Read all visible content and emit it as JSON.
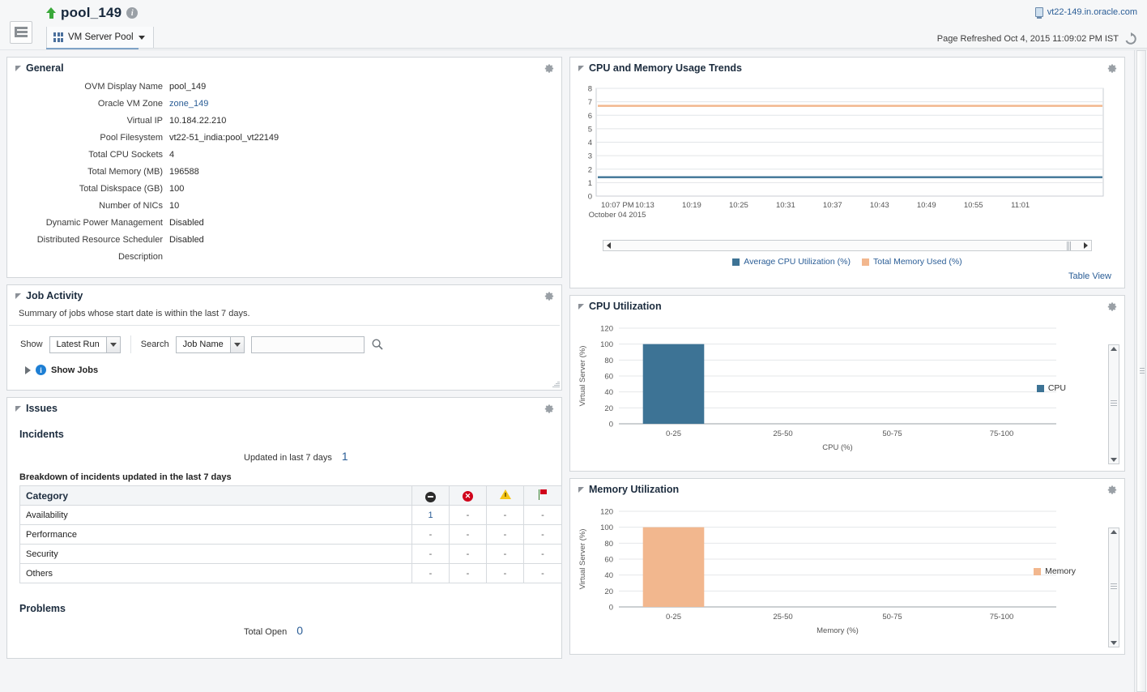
{
  "header": {
    "page_title": "pool_149",
    "info_icon": "info-icon",
    "status_icon": "up-arrow-icon",
    "target_menu_label": "VM Server Pool",
    "host_link": "vt22-149.in.oracle.com",
    "refresh_text": "Page Refreshed Oct 4, 2015 11:09:02 PM IST",
    "sidebar_toggle_icon": "sidebar-toggle-icon",
    "refresh_icon": "refresh-icon"
  },
  "general": {
    "title": "General",
    "gear_icon": "gear-icon",
    "rows": [
      {
        "label": "OVM Display Name",
        "value": "pool_149",
        "link": false
      },
      {
        "label": "Oracle VM Zone",
        "value": "zone_149",
        "link": true
      },
      {
        "label": "Virtual IP",
        "value": "10.184.22.210",
        "link": false
      },
      {
        "label": "Pool Filesystem",
        "value": "vt22-51_india:pool_vt22149",
        "link": false
      },
      {
        "label": "Total CPU Sockets",
        "value": "4",
        "link": false
      },
      {
        "label": "Total Memory (MB)",
        "value": "196588",
        "link": false
      },
      {
        "label": "Total Diskspace (GB)",
        "value": "100",
        "link": false
      },
      {
        "label": "Number of NICs",
        "value": "10",
        "link": false
      },
      {
        "label": "Dynamic Power Management",
        "value": "Disabled",
        "link": false
      },
      {
        "label": "Distributed Resource Scheduler",
        "value": "Disabled",
        "link": false
      },
      {
        "label": "Description",
        "value": "",
        "link": false
      }
    ]
  },
  "job_activity": {
    "title": "Job Activity",
    "gear_icon": "gear-icon",
    "description": "Summary of jobs whose start date is within the last 7 days.",
    "show_label": "Show",
    "show_value": "Latest Run",
    "search_label": "Search",
    "search_value": "Job Name",
    "search_input_value": "",
    "search_icon": "search-icon",
    "show_jobs_label": "Show Jobs"
  },
  "issues": {
    "title": "Issues",
    "gear_icon": "gear-icon",
    "incidents_heading": "Incidents",
    "updated_label": "Updated in last 7 days",
    "updated_count": "1",
    "breakdown_label": "Breakdown of incidents updated in the last 7 days",
    "table": {
      "columns": [
        "Category",
        "fatal-icon",
        "critical-icon",
        "warning-icon",
        "flag-icon"
      ],
      "category_header": "Category",
      "rows": [
        {
          "category": "Availability",
          "fatal": "1",
          "critical": "-",
          "warning": "-",
          "flag": "-",
          "fatal_link": true
        },
        {
          "category": "Performance",
          "fatal": "-",
          "critical": "-",
          "warning": "-",
          "flag": "-",
          "fatal_link": false
        },
        {
          "category": "Security",
          "fatal": "-",
          "critical": "-",
          "warning": "-",
          "flag": "-",
          "fatal_link": false
        },
        {
          "category": "Others",
          "fatal": "-",
          "critical": "-",
          "warning": "-",
          "flag": "-",
          "fatal_link": false
        }
      ]
    },
    "problems_heading": "Problems",
    "total_open_label": "Total Open",
    "total_open_value": "0"
  },
  "colors": {
    "cpu_blue": "#3d7395",
    "memory_orange": "#f2b78e",
    "link_blue": "#2a5d96"
  },
  "trends_panel": {
    "title": "CPU and Memory Usage Trends",
    "gear_icon": "gear-icon",
    "table_view_link": "Table View",
    "scroll_left_icon": "scroll-left-icon",
    "scroll_right_icon": "scroll-right-icon"
  },
  "cpu_panel": {
    "title": "CPU Utilization",
    "gear_icon": "gear-icon"
  },
  "memory_panel": {
    "title": "Memory Utilization",
    "gear_icon": "gear-icon"
  },
  "chart_data": [
    {
      "type": "line",
      "title": "CPU and Memory Usage Trends",
      "xlabel": "October 04 2015",
      "ylabel": "",
      "ylim": [
        0,
        8
      ],
      "yticks": [
        0,
        1,
        2,
        3,
        4,
        5,
        6,
        7,
        8
      ],
      "x": [
        "10:07 PM",
        "10:13",
        "10:19",
        "10:25",
        "10:31",
        "10:37",
        "10:43",
        "10:49",
        "10:55",
        "11:01"
      ],
      "grid": true,
      "legend_position": "bottom",
      "series": [
        {
          "name": "Average CPU Utilization (%)",
          "color": "#3d7395",
          "values": [
            1.4,
            1.4,
            1.4,
            1.4,
            1.4,
            1.4,
            1.4,
            1.4,
            1.4,
            1.4
          ]
        },
        {
          "name": "Total Memory Used (%)",
          "color": "#f2b78e",
          "values": [
            6.7,
            6.7,
            6.7,
            6.7,
            6.7,
            6.7,
            6.7,
            6.7,
            6.7,
            6.7
          ]
        }
      ]
    },
    {
      "type": "bar",
      "title": "CPU Utilization",
      "xlabel": "CPU (%)",
      "ylabel": "Virtual Server (%)",
      "ylim": [
        0,
        120
      ],
      "yticks": [
        0,
        20,
        40,
        60,
        80,
        100,
        120
      ],
      "categories": [
        "0-25",
        "25-50",
        "50-75",
        "75-100"
      ],
      "grid": true,
      "legend_position": "right",
      "series": [
        {
          "name": "CPU",
          "color": "#3d7395",
          "values": [
            100,
            0,
            0,
            0
          ]
        }
      ]
    },
    {
      "type": "bar",
      "title": "Memory Utilization",
      "xlabel": "Memory (%)",
      "ylabel": "Virtual Server (%)",
      "ylim": [
        0,
        120
      ],
      "yticks": [
        0,
        20,
        40,
        60,
        80,
        100,
        120
      ],
      "categories": [
        "0-25",
        "25-50",
        "50-75",
        "75-100"
      ],
      "grid": true,
      "legend_position": "right",
      "series": [
        {
          "name": "Memory",
          "color": "#f2b78e",
          "values": [
            100,
            0,
            0,
            0
          ]
        }
      ]
    }
  ]
}
